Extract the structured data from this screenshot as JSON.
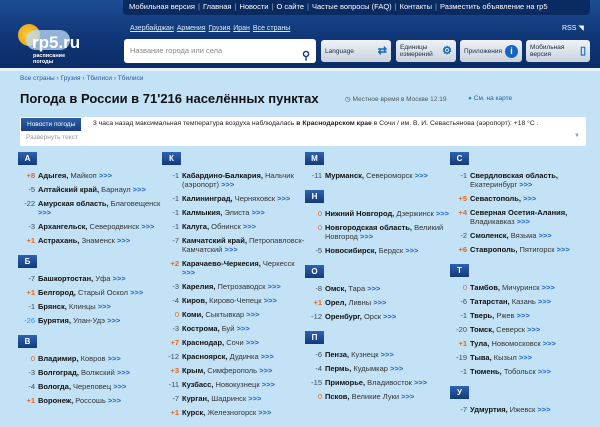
{
  "topnav": [
    "Мобильная версия",
    "Главная",
    "Новости",
    "О сайте",
    "Частые вопросы (FAQ)",
    "Контакты",
    "Разместить объявление на rp5"
  ],
  "logo": {
    "name": "rp5.ru",
    "sub1": "расписание",
    "sub2": "погоды"
  },
  "countries": [
    "Азербайджан",
    "Армения",
    "Грузия",
    "Иран",
    "Все страны"
  ],
  "rss": "RSS",
  "search": {
    "placeholder": "Название города или села"
  },
  "buttons": [
    {
      "label": "Language",
      "icon": "translate-icon"
    },
    {
      "label": "Единицы измерений",
      "icon": "gear-icon"
    },
    {
      "label": "Приложения",
      "icon": "info-icon"
    },
    {
      "label": "Мобильная версия",
      "icon": "mobile-icon"
    }
  ],
  "breadcrumb": "Все страны › Грузия › Тбилиси › Тбилиси",
  "title": "Погода в России в 71'216 населённых пунктах",
  "moscow_time": "Местное время в Москве  12:19",
  "map_link": "См. на карте",
  "news": {
    "button": "Новости погоды",
    "text_pre": "3 часа назад максимальная температура воздуха наблюдалась ",
    "text_bold": "в Краснодарском крае",
    "text_post": " в Сочи / им. В. И. Севастьянова (аэропорт): +18 °C .",
    "expand": "Развернуть текст"
  },
  "more": ">>>",
  "colors": {
    "header": "#0f3474",
    "positive": "#e8641e",
    "link": "#1a5fc0",
    "background": "#c3e2f6"
  },
  "columns": [
    [
      {
        "letter": "А",
        "items": [
          [
            "+8",
            "Адыгея,",
            "Майкоп"
          ],
          [
            "-5",
            "Алтайский край,",
            "Барнаул"
          ],
          [
            "-22",
            "Амурская область,",
            "Благовещенск"
          ],
          [
            "-3",
            "Архангельск,",
            "Северодвинск"
          ],
          [
            "+1",
            "Астрахань,",
            "Знаменск"
          ]
        ]
      },
      {
        "letter": "Б",
        "items": [
          [
            "-7",
            "Башкортостан,",
            "Уфа"
          ],
          [
            "+1",
            "Белгород,",
            "Старый Оскол"
          ],
          [
            "-1",
            "Брянск,",
            "Клинцы"
          ],
          [
            "-26",
            "Бурятия,",
            "Улан-Удэ"
          ]
        ]
      },
      {
        "letter": "В",
        "items": [
          [
            "0",
            "Владимир,",
            "Ковров"
          ],
          [
            "-3",
            "Волгоград,",
            "Волжский"
          ],
          [
            "-4",
            "Вологда,",
            "Череповец"
          ],
          [
            "+1",
            "Воронеж,",
            "Россошь"
          ]
        ]
      }
    ],
    [
      {
        "letter": "К",
        "items": [
          [
            "-1",
            "Кабардино-Балкария,",
            "Нальчик (аэропорт)"
          ],
          [
            "-1",
            "Калининград,",
            "Черняховск"
          ],
          [
            "-1",
            "Калмыкия,",
            "Элиста"
          ],
          [
            "-1",
            "Калуга,",
            "Обнинск"
          ],
          [
            "-7",
            "Камчатский край,",
            "Петропавловск-Камчатский"
          ],
          [
            "+2",
            "Карачаево-Черкесия,",
            "Черкесск"
          ],
          [
            "-3",
            "Карелия,",
            "Петрозаводск"
          ],
          [
            "-4",
            "Киров,",
            "Кирово-Чепецк"
          ],
          [
            "0",
            "Коми,",
            "Сыктывкар"
          ],
          [
            "-3",
            "Кострома,",
            "Буй"
          ],
          [
            "+7",
            "Краснодар,",
            "Сочи"
          ],
          [
            "-12",
            "Красноярск,",
            "Дудинка"
          ],
          [
            "+3",
            "Крым,",
            "Симферополь"
          ],
          [
            "-11",
            "Кузбасс,",
            "Новокузнецк"
          ],
          [
            "-7",
            "Курган,",
            "Шадринск"
          ],
          [
            "+1",
            "Курск,",
            "Железногорск"
          ]
        ]
      }
    ],
    [
      {
        "letter": "М",
        "items": [
          [
            "-11",
            "Мурманск,",
            "Североморск"
          ]
        ]
      },
      {
        "letter": "Н",
        "items": [
          [
            "0",
            "Нижний Новгород,",
            "Дзержинск"
          ],
          [
            "0",
            "Новгородская область,",
            "Великий Новгород"
          ],
          [
            "-5",
            "Новосибирск,",
            "Бердск"
          ]
        ]
      },
      {
        "letter": "О",
        "items": [
          [
            "-8",
            "Омск,",
            "Тара"
          ],
          [
            "+1",
            "Орел,",
            "Ливны"
          ],
          [
            "-12",
            "Оренбург,",
            "Орск"
          ]
        ]
      },
      {
        "letter": "П",
        "items": [
          [
            "-6",
            "Пенза,",
            "Кузнецк"
          ],
          [
            "-4",
            "Пермь,",
            "Кудымкар"
          ],
          [
            "-15",
            "Приморье,",
            "Владивосток"
          ],
          [
            "0",
            "Псков,",
            "Великие Луки"
          ]
        ]
      }
    ],
    [
      {
        "letter": "С",
        "items": [
          [
            "-1",
            "Свердловская область,",
            "Екатеринбург"
          ],
          [
            "+5",
            "Севастополь,",
            ""
          ],
          [
            "+4",
            "Северная Осетия-Алания,",
            "Владикавказ"
          ],
          [
            "-2",
            "Смоленск,",
            "Вязьма"
          ],
          [
            "+6",
            "Ставрополь,",
            "Пятигорск"
          ]
        ]
      },
      {
        "letter": "Т",
        "items": [
          [
            "0",
            "Тамбов,",
            "Мичуринск"
          ],
          [
            "-6",
            "Татарстан,",
            "Казань"
          ],
          [
            "-1",
            "Тверь,",
            "Ржев"
          ],
          [
            "-20",
            "Томск,",
            "Северск"
          ],
          [
            "+1",
            "Тула,",
            "Новомосковск"
          ],
          [
            "-19",
            "Тыва,",
            "Кызыл"
          ],
          [
            "-1",
            "Тюмень,",
            "Тобольск"
          ]
        ]
      },
      {
        "letter": "У",
        "items": [
          [
            "-7",
            "Удмуртия,",
            "Ижевск"
          ]
        ]
      }
    ]
  ]
}
